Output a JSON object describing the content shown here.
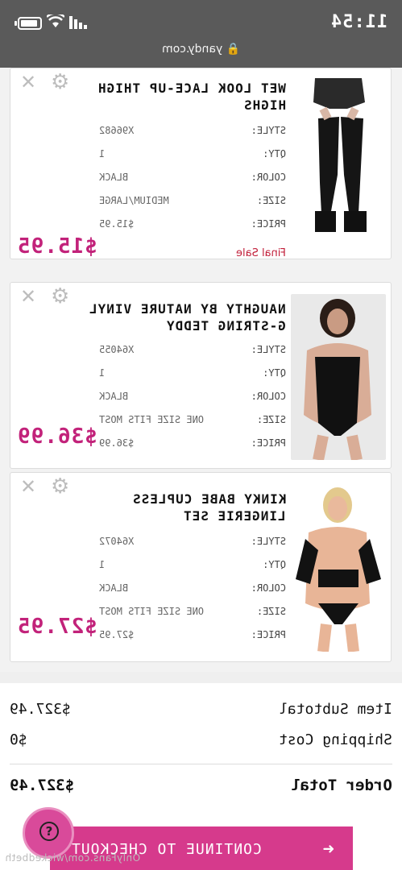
{
  "status": {
    "time": "11:54",
    "url": "yandy.com"
  },
  "items": [
    {
      "title_line1": "WET LOOK LACE-UP THIGH",
      "title_line2": "HIGHS",
      "specs": [
        {
          "k": "STYLE:",
          "v": "X96682"
        },
        {
          "k": "QTY:",
          "v": "1"
        },
        {
          "k": "COLOR:",
          "v": "BLACK"
        },
        {
          "k": "SIZE:",
          "v": "MEDIUM/LARGE"
        },
        {
          "k": "PRICE:",
          "v": "$15.95"
        }
      ],
      "total": "$15.95",
      "note": "Final Sale"
    },
    {
      "title_line1": "NAUGHTY BY NATURE VINYL",
      "title_line2": "G-STRING TEDDY",
      "specs": [
        {
          "k": "STYLE:",
          "v": "X64055"
        },
        {
          "k": "QTY:",
          "v": "1"
        },
        {
          "k": "COLOR:",
          "v": "BLACK"
        },
        {
          "k": "SIZE:",
          "v": "ONE SIZE FITS MOST"
        },
        {
          "k": "PRICE:",
          "v": "$36.99"
        }
      ],
      "total": "$36.99"
    },
    {
      "title_line1": "KINKY BABE CUPLESS",
      "title_line2": "LINGERIE SET",
      "specs": [
        {
          "k": "STYLE:",
          "v": "X64072"
        },
        {
          "k": "QTY:",
          "v": "1"
        },
        {
          "k": "COLOR:",
          "v": "BLACK"
        },
        {
          "k": "SIZE:",
          "v": "ONE SIZE FITS MOST"
        },
        {
          "k": "PRICE:",
          "v": "$27.95"
        }
      ],
      "total": "$27.95"
    }
  ],
  "summary": {
    "subtotal_label": "Item Subtotal",
    "subtotal_value": "$327.49",
    "shipping_label": "Shipping Cost",
    "shipping_value": "$0",
    "total_label": "Order Total",
    "total_value": "$327.49"
  },
  "checkout_label": "CONTINUE TO CHECKOUT",
  "help_icon": "?",
  "watermark": "OnlyFans.com/wickedbeth",
  "colors": {
    "accent": "#d63a8c",
    "price": "#c2227a",
    "final_sale": "#c21f3a"
  }
}
